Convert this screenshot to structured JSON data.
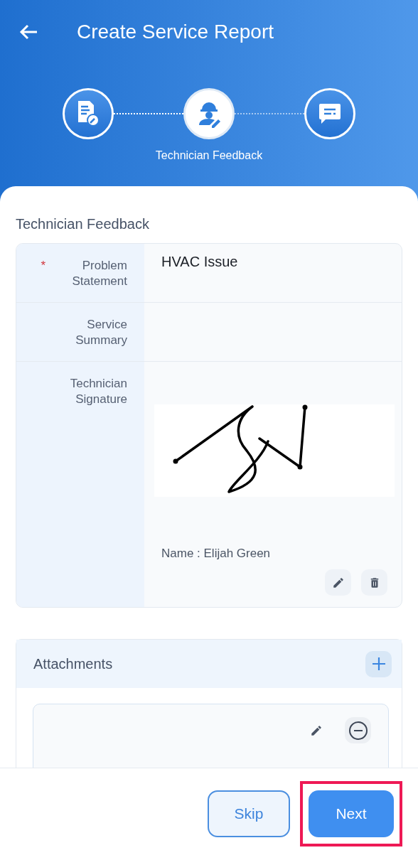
{
  "header": {
    "title": "Create Service Report"
  },
  "steps": [
    {
      "kind": "report",
      "selected": false
    },
    {
      "kind": "technician",
      "selected": true,
      "label": "Technician Feedback"
    },
    {
      "kind": "message",
      "selected": false
    }
  ],
  "section_title": "Technician Feedback",
  "fields": [
    {
      "kind": "text",
      "required_mark": "*",
      "label": "Problem Statement",
      "value": "HVAC Issue"
    },
    {
      "kind": "text",
      "label": "Service Summary"
    },
    {
      "kind": "signature",
      "label": "Technician Signature",
      "signer": "Name : Elijah Green"
    }
  ],
  "attachments": {
    "title": "Attachments"
  },
  "buttons": [
    {
      "kind": "secondary",
      "label": "Skip",
      "highlighted": false
    },
    {
      "kind": "primary",
      "label": "Next",
      "highlighted": true
    }
  ]
}
